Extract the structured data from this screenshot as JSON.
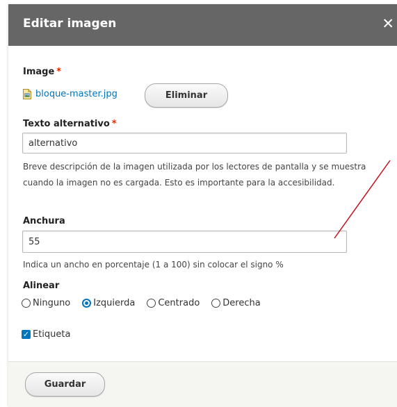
{
  "dialog": {
    "title": "Editar imagen",
    "close_glyph": "✕"
  },
  "image_field": {
    "label": "Image",
    "required_mark": "*",
    "file_name": "bloque-master.jpg",
    "file_icon": "image-file-icon",
    "remove_label": "Eliminar"
  },
  "alt_field": {
    "label": "Texto alternativo",
    "required_mark": "*",
    "value": "alternativo",
    "description": "Breve descripción de la imagen utilizada por los lectores de pantalla y se muestra cuando la imagen no es cargada. Esto es importante para la accesibilidad."
  },
  "width_field": {
    "label": "Anchura",
    "value": "55",
    "description": "Indica un ancho en porcentaje (1 a 100) sin colocar el signo %"
  },
  "align": {
    "label": "Alinear",
    "options": [
      "Ninguno",
      "Izquierda",
      "Centrado",
      "Derecha"
    ],
    "selected": "Izquierda"
  },
  "caption": {
    "label": "Etiqueta",
    "checked": true
  },
  "footer": {
    "save_label": "Guardar"
  },
  "colors": {
    "titlebar": "#666666",
    "link": "#0074bd",
    "required": "#e62600",
    "annotation_line": "#c0121d"
  }
}
